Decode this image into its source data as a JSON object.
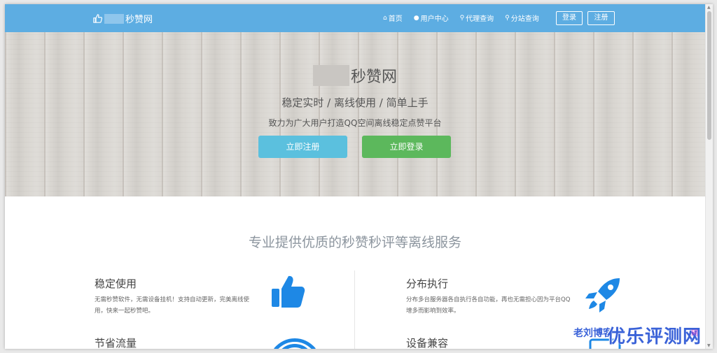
{
  "navbar": {
    "brand_suffix": "秒赞网",
    "links": [
      {
        "icon": "home-icon",
        "glyph": "⌂",
        "label": "首页"
      },
      {
        "icon": "user-icon",
        "glyph": "●",
        "label": "用户中心"
      },
      {
        "icon": "search-icon",
        "glyph": "⚲",
        "label": "代理查询"
      },
      {
        "icon": "search-plus-icon",
        "glyph": "⚲",
        "label": "分站查询"
      }
    ],
    "login_label": "登录",
    "register_label": "注册"
  },
  "hero": {
    "title_suffix": "秒赞网",
    "slogan": "稳定实时 / 离线使用 / 简单上手",
    "description": "致力为广大用户打造QQ空间离线稳定点赞平台",
    "register_button": "立即注册",
    "login_button": "立即登录"
  },
  "services": {
    "heading": "专业提供优质的秒赞秒评等离线服务",
    "features": [
      {
        "title": "稳定使用",
        "description": "无需秒赞软件，无需设备挂机！支持自动更新，完美离线使用，快来一起秒赞吧。",
        "icon": "thumbs-up-icon"
      },
      {
        "title": "分布执行",
        "description": "分布多台服务器各自执行各自功能，再也无需担心因为平台QQ增多而影响到效率。",
        "icon": "rocket-icon"
      },
      {
        "title": "节省流量",
        "description": "",
        "icon": "wifi-icon"
      },
      {
        "title": "设备兼容",
        "description": "",
        "icon": "device-icon"
      }
    ]
  },
  "watermark": {
    "author": "老刘博客",
    "site": "优乐评测网",
    "tail": "网"
  },
  "colors": {
    "navbar": "#5dade2",
    "register": "#5bc0de",
    "login": "#5cb85c",
    "icon_blue": "#1e88e5",
    "heading_gray": "#8c959e"
  }
}
